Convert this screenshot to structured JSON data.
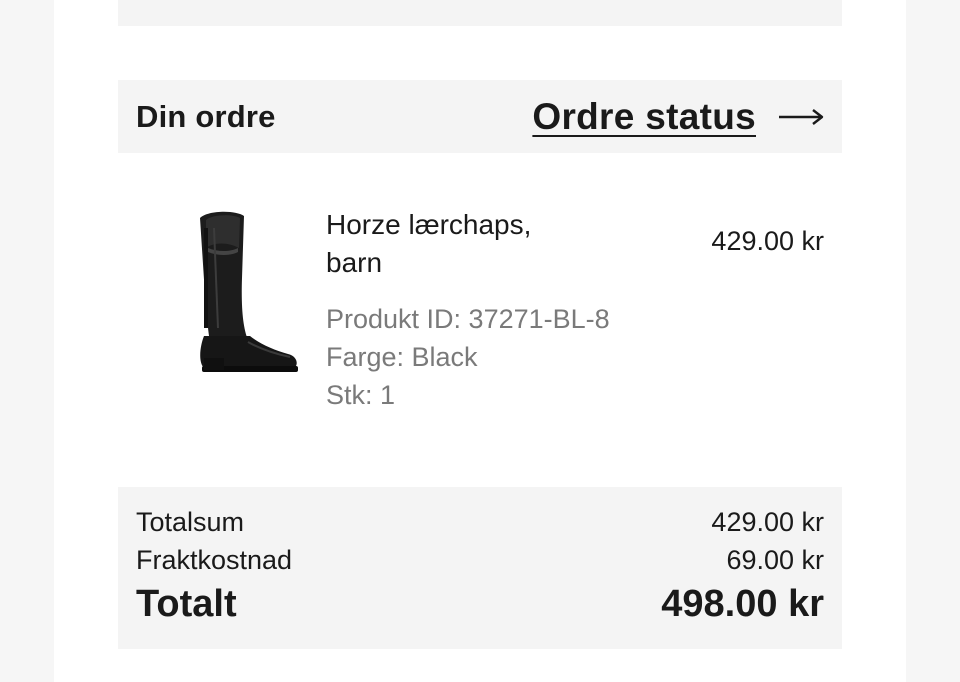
{
  "order": {
    "title": "Din ordre",
    "status_link": "Ordre status"
  },
  "product": {
    "name_line1": "Horze lærchaps,",
    "name_line2": "barn",
    "product_id": "Produkt ID: 37271-BL-8",
    "color": "Farge: Black",
    "quantity": "Stk: 1",
    "price": "429.00 kr",
    "image_icon": "riding-chaps-boot-image"
  },
  "summary": {
    "subtotal_label": "Totalsum",
    "subtotal_value": "429.00 kr",
    "shipping_label": "Fraktkostnad",
    "shipping_value": "69.00 kr",
    "total_label": "Totalt",
    "total_value": "498.00 kr"
  },
  "colors": {
    "panel_bg": "#f4f4f4",
    "text": "#1a1a1a",
    "muted": "#7a7a7a"
  }
}
